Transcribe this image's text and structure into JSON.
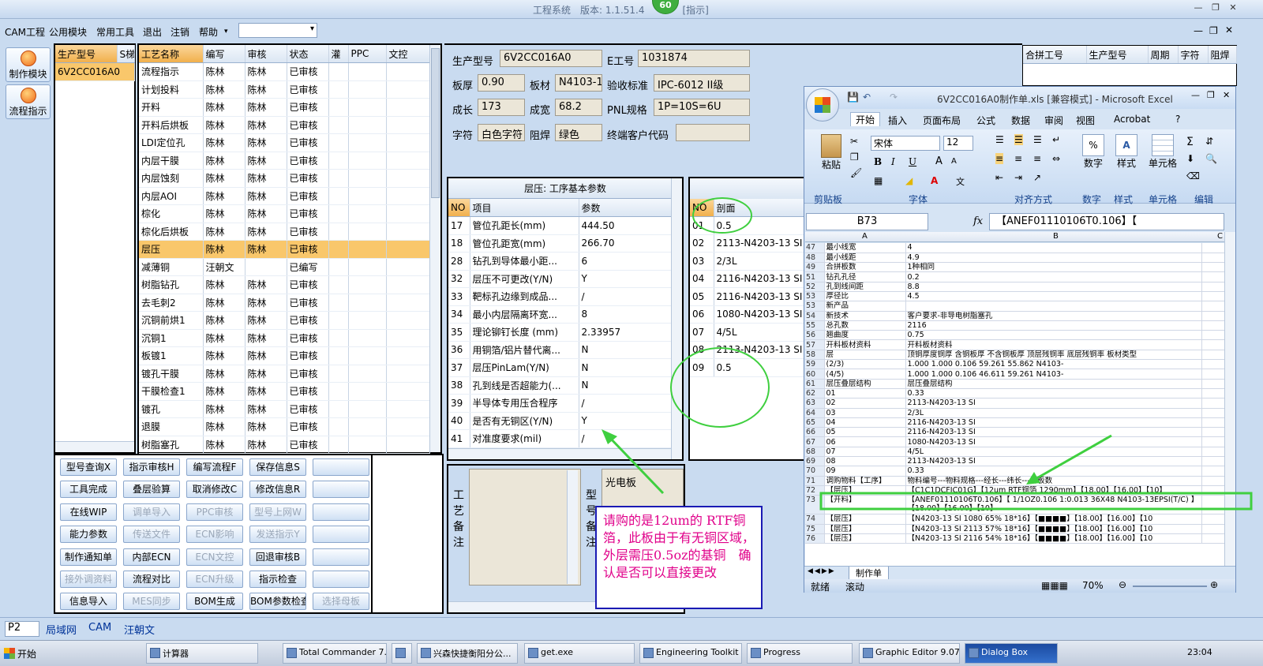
{
  "titlebar": {
    "title": "工程系统　版本: 1.1.51.4　　　　[指示]",
    "badge": "60"
  },
  "menu": [
    "CAM工程",
    "公用模块",
    "常用工具",
    "退出",
    "注销",
    "帮助"
  ],
  "left_modules": [
    "制作模块",
    "流程指示"
  ],
  "model_list": {
    "headers": [
      "生产型号",
      "S梯"
    ],
    "items": [
      "6V2CC016A0"
    ]
  },
  "process_grid": {
    "headers": [
      "工艺名称",
      "编写",
      "审核",
      "状态",
      "灌",
      "PPC",
      "文控"
    ],
    "rows": [
      [
        "流程指示",
        "陈林",
        "陈林",
        "已审核"
      ],
      [
        "计划投料",
        "陈林",
        "陈林",
        "已审核"
      ],
      [
        "开料",
        "陈林",
        "陈林",
        "已审核"
      ],
      [
        "开料后烘板",
        "陈林",
        "陈林",
        "已审核"
      ],
      [
        "LDI定位孔",
        "陈林",
        "陈林",
        "已审核"
      ],
      [
        "内层干膜",
        "陈林",
        "陈林",
        "已审核"
      ],
      [
        "内层蚀刻",
        "陈林",
        "陈林",
        "已审核"
      ],
      [
        "内层AOI",
        "陈林",
        "陈林",
        "已审核"
      ],
      [
        "棕化",
        "陈林",
        "陈林",
        "已审核"
      ],
      [
        "棕化后烘板",
        "陈林",
        "陈林",
        "已审核"
      ],
      [
        "层压",
        "陈林",
        "陈林",
        "已审核"
      ],
      [
        "减薄铜",
        "汪朝文",
        "",
        "已编写"
      ],
      [
        "树脂钻孔",
        "陈林",
        "陈林",
        "已审核"
      ],
      [
        "去毛刺2",
        "陈林",
        "陈林",
        "已审核"
      ],
      [
        "沉铜前烘1",
        "陈林",
        "陈林",
        "已审核"
      ],
      [
        "沉铜1",
        "陈林",
        "陈林",
        "已审核"
      ],
      [
        "板镀1",
        "陈林",
        "陈林",
        "已审核"
      ],
      [
        "镀孔干膜",
        "陈林",
        "陈林",
        "已审核"
      ],
      [
        "干膜检查1",
        "陈林",
        "陈林",
        "已审核"
      ],
      [
        "镀孔",
        "陈林",
        "陈林",
        "已审核"
      ],
      [
        "退膜",
        "陈林",
        "陈林",
        "已审核"
      ],
      [
        "树脂塞孔",
        "陈林",
        "陈林",
        "已审核"
      ]
    ],
    "selected_index": 10
  },
  "buttons": [
    [
      "型号查询X",
      "指示审核H",
      "编写流程F",
      "保存信息S",
      ""
    ],
    [
      "工具完成",
      "叠层验算",
      "取消修改C",
      "修改信息R",
      ""
    ],
    [
      "在线WIP",
      "调单导入",
      "PPC审核",
      "型号上网W",
      ""
    ],
    [
      "能力参数",
      "传送文件",
      "ECN影响",
      "发送指示Y",
      ""
    ],
    [
      "制作通知单",
      "内部ECN",
      "ECN文控",
      "回退审核B",
      ""
    ],
    [
      "接外调资料",
      "流程对比",
      "ECN升级",
      "指示检查",
      ""
    ],
    [
      "信息导入",
      "MES同步",
      "BOM生成",
      "BOM参数检查",
      "选择母板"
    ]
  ],
  "disabled_buttons": [
    "调单导入",
    "PPC审核",
    "型号上网W",
    "传送文件",
    "ECN影响",
    "发送指示Y",
    "ECN文控",
    "接外调资料",
    "ECN升级",
    "MES同步",
    "选择母板"
  ],
  "info": {
    "prod_model_label": "生产型号",
    "prod_model": "6V2CC016A0",
    "e_no_label": "E工号",
    "e_no": "1031874",
    "thickness_label": "板厚",
    "thickness": "0.90",
    "material_label": "板材",
    "material": "N4103-1",
    "accept_label": "验收标准",
    "accept": "IPC-6012 II级",
    "length_label": "成长",
    "length": "173",
    "width_label": "成宽",
    "width": "68.2",
    "pnl_label": "PNL规格",
    "pnl": "1P=10S=6U",
    "char_label": "字符",
    "char": "白色字符",
    "mask_label": "阻焊",
    "mask": "绿色",
    "customer_label": "终端客户代码",
    "customer": ""
  },
  "param_grid": {
    "title": "层压: 工序基本参数",
    "headers": [
      "NO",
      "项目",
      "参数"
    ],
    "rows": [
      [
        "17",
        "管位孔距长(mm)",
        "444.50"
      ],
      [
        "18",
        "管位孔距宽(mm)",
        "266.70"
      ],
      [
        "28",
        "钻孔到导体最小距...",
        "6"
      ],
      [
        "32",
        "层压不可更改(Y/N)",
        "Y"
      ],
      [
        "33",
        "靶标孔边缘到成品...",
        "/"
      ],
      [
        "34",
        "最小内层隔离环宽...",
        "8"
      ],
      [
        "35",
        "理论铆钉长度 (mm)",
        "2.33957"
      ],
      [
        "36",
        "用铜箔/铝片替代离...",
        "N"
      ],
      [
        "37",
        "层压PinLam(Y/N)",
        "N"
      ],
      [
        "38",
        "孔到线是否超能力(...",
        "N"
      ],
      [
        "39",
        "半导体专用压合程序",
        "/"
      ],
      [
        "40",
        "是否有无铜区(Y/N)",
        "Y"
      ],
      [
        "41",
        "对准度要求(mil)",
        "/"
      ]
    ]
  },
  "section_grid": {
    "headers": [
      "NO",
      "剖面"
    ],
    "rows": [
      [
        "01",
        "0.5"
      ],
      [
        "02",
        "2113-N4203-13 SI"
      ],
      [
        "03",
        "2/3L"
      ],
      [
        "04",
        "2116-N4203-13 SI"
      ],
      [
        "05",
        "2116-N4203-13 SI"
      ],
      [
        "06",
        "1080-N4203-13 SI"
      ],
      [
        "07",
        "4/5L"
      ],
      [
        "08",
        "2113-N4203-13 SI"
      ],
      [
        "09",
        "0.5"
      ]
    ]
  },
  "merge_grid": {
    "headers": [
      "合拼工号",
      "生产型号",
      "周期",
      "字符",
      "阻焊"
    ]
  },
  "notes": {
    "craft_label": "工艺备注",
    "model_label": "型号备注",
    "board_type": "光电板"
  },
  "annotation_note": "请购的是12um的 RTF铜箔，此板由于有无铜区域，外层需压0.5oz的基铜　确认是否可以直接更改",
  "excel": {
    "title": "6V2CC016A0制作单.xls  [兼容模式] - Microsoft Excel",
    "tabs": [
      "开始",
      "插入",
      "页面布局",
      "公式",
      "数据",
      "审阅",
      "视图",
      "Acrobat"
    ],
    "font_name": "宋体",
    "font_size": "12",
    "groups": [
      "剪贴板",
      "字体",
      "对齐方式",
      "数字",
      "样式",
      "单元格",
      "编辑"
    ],
    "paste_label": "粘贴",
    "number_label": "数字",
    "style_label": "样式",
    "cell_label": "单元格",
    "cell_ref": "B73",
    "formula": "【ANEF01110106T0.106】【",
    "col_a": "A",
    "col_b": "B",
    "col_c": "C",
    "rows": [
      [
        "47",
        "最小线宽",
        "4"
      ],
      [
        "48",
        "最小线距",
        "4.9"
      ],
      [
        "49",
        "合拼板数",
        "1种相同"
      ],
      [
        "51",
        "钻孔孔径",
        "0.2"
      ],
      [
        "52",
        "孔到线间距",
        "8.8"
      ],
      [
        "53",
        "厚径比",
        "4.5"
      ],
      [
        "53",
        "新产品",
        ""
      ],
      [
        "54",
        "新技术",
        "客户要求-非导电树脂塞孔"
      ],
      [
        "55",
        "总孔数",
        "2116"
      ],
      [
        "56",
        "翘曲度",
        "0.75"
      ],
      [
        "57",
        "开料板材资料",
        "开料板材资料"
      ],
      [
        "58",
        "层",
        "顶铜厚度铜厚 含铜板厚 不含铜板厚 顶层残铜率 底层残铜率 板材类型"
      ],
      [
        "59",
        "(2/3)",
        "1.000  1.000         0.106       59.261      55.862     N4103-"
      ],
      [
        "60",
        "(4/5)",
        "1.000  1.000         0.106       46.611      59.261     N4103-"
      ],
      [
        "61",
        "层压叠层结构",
        "层压叠层结构"
      ],
      [
        "62",
        "01",
        "0.33"
      ],
      [
        "63",
        "02",
        "2113-N4203-13 SI"
      ],
      [
        "64",
        "03",
        "2/3L"
      ],
      [
        "65",
        "04",
        "2116-N4203-13 SI"
      ],
      [
        "66",
        "05",
        "2116-N4203-13 SI"
      ],
      [
        "67",
        "06",
        "1080-N4203-13 SI"
      ],
      [
        "68",
        "07",
        "4/5L"
      ],
      [
        "69",
        "08",
        "2113-N4203-13 SI"
      ],
      [
        "70",
        "09",
        "0.33"
      ],
      [
        "71",
        "调购物料【工序】",
        "物料编号---物料规格---经长---纬长---拼板数"
      ],
      [
        "72",
        "【层压】",
        "【C1C1DCFIC01G】【12um RTF铜箔 1290mm】【18.00】【16.00】【10】"
      ],
      [
        "73",
        "【开料】",
        "【ANEF01110106T0.106】【 1/1OZ0.106 1:0.013 36X48  N4103-13EPSI(T/C) 】【18.00】【16.00】【10】"
      ],
      [
        "74",
        "【层压】",
        "【N4203-13 SI 1080 65% 18*16】【■■■■】【18.00】【16.00】【10"
      ],
      [
        "75",
        "【层压】",
        "【N4203-13 SI 2113 57% 18*16】【■■■■】【18.00】【16.00】【10"
      ],
      [
        "76",
        "【层压】",
        "【N4203-13 SI 2116 54% 18*16】【■■■■】【18.00】【16.00】【10"
      ]
    ],
    "sheet_tab": "制作单",
    "status_left": "就绪",
    "status_mid": "滚动",
    "zoom": "70%"
  },
  "bottom_bar": {
    "combo": "P2",
    "tabs": [
      "局域网",
      "CAM",
      "汪朝文"
    ]
  },
  "taskbar": {
    "start": "开始",
    "items": [
      "计算器",
      "Total Commander 7....",
      "",
      "兴森快捷衡阳分公...",
      "get.exe",
      "Engineering Toolkit 9...",
      "Progress",
      "Graphic Editor 9.07b...",
      "Dialog Box"
    ],
    "clock": "23:04"
  }
}
